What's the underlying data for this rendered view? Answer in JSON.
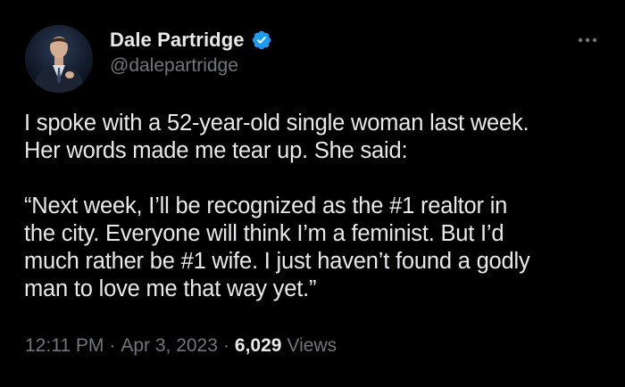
{
  "author": {
    "display_name": "Dale Partridge",
    "handle": "@dalepartridge",
    "verified_icon": "verified-badge-icon",
    "badge_color": "#1d9bf0"
  },
  "tweet": {
    "lines": [
      "I spoke with a 52-year-old single woman last week.",
      "Her words made me tear up. She said:",
      "",
      "“Next week, I’ll be recognized as the #1 realtor in",
      "the city. Everyone will think I’m a feminist. But I’d",
      "much rather be #1 wife. I just haven’t found a godly",
      "man to love me that way yet.”"
    ]
  },
  "meta": {
    "time": "12:11 PM",
    "separator": "·",
    "date": "Apr 3, 2023",
    "views_count": "6,029",
    "views_label": "Views"
  },
  "colors": {
    "background": "#000000",
    "text_primary": "#e7e9ea",
    "text_secondary": "#71767b"
  },
  "icons": {
    "more": "more-horizontal-icon"
  }
}
